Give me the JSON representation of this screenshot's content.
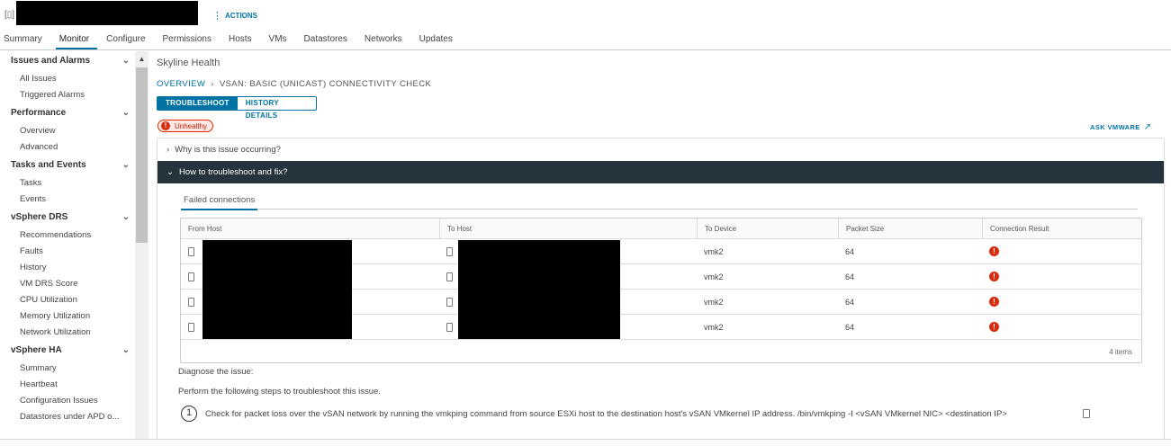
{
  "header": {
    "actions_label": "ACTIONS"
  },
  "tabs": [
    "Summary",
    "Monitor",
    "Configure",
    "Permissions",
    "Hosts",
    "VMs",
    "Datastores",
    "Networks",
    "Updates"
  ],
  "sidebar": [
    {
      "title": "Issues and Alarms",
      "items": [
        "All Issues",
        "Triggered Alarms"
      ]
    },
    {
      "title": "Performance",
      "items": [
        "Overview",
        "Advanced"
      ]
    },
    {
      "title": "Tasks and Events",
      "items": [
        "Tasks",
        "Events"
      ]
    },
    {
      "title": "vSphere DRS",
      "items": [
        "Recommendations",
        "Faults",
        "History",
        "VM DRS Score",
        "CPU Utilization",
        "Memory Utilization",
        "Network Utilization"
      ]
    },
    {
      "title": "vSphere HA",
      "items": [
        "Summary",
        "Heartbeat",
        "Configuration Issues",
        "Datastores under APD o..."
      ]
    }
  ],
  "main": {
    "title": "Skyline Health",
    "breadcrumb_root": "OVERVIEW",
    "breadcrumb_current": "VSAN: BASIC (UNICAST) CONNECTIVITY CHECK",
    "seg_troubleshoot": "TROUBLESHOOT",
    "seg_history": "HISTORY DETAILS",
    "status": "Unhealthy",
    "ask_vmware": "ASK VMWARE",
    "why_label": "Why is this issue occurring?",
    "how_label": "How to troubleshoot and fix?",
    "inner_tab": "Failed connections",
    "columns": [
      "From Host",
      "To Host",
      "To Device",
      "Packet Size",
      "Connection Result"
    ],
    "rows": [
      {
        "to_device": "vmk2",
        "packet_size": "64"
      },
      {
        "to_device": "vmk2",
        "packet_size": "64"
      },
      {
        "to_device": "vmk2",
        "packet_size": "64"
      },
      {
        "to_device": "vmk2",
        "packet_size": "64"
      }
    ],
    "footer_count": "4 items",
    "diagnose": "Diagnose the issue:",
    "perform": "Perform the following steps to troubleshoot this issue.",
    "step_num": "1",
    "step_text": "Check for packet loss over the vSAN network by running the vmkping command from source ESXi host to the destination host's vSAN VMkernel IP address. /bin/vmkping -I <vSAN VMkernel NIC> <destination IP>"
  },
  "colors": {
    "accent": "#0072a3",
    "dark_header": "#25333d",
    "error": "#d92b0f"
  }
}
